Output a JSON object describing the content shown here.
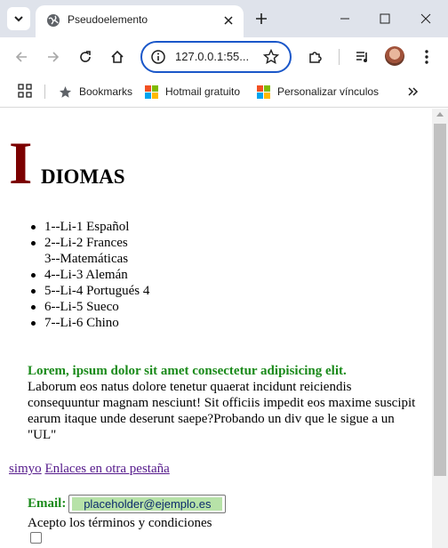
{
  "browser": {
    "tab_title": "Pseudoelemento",
    "url": "127.0.0.1:55...",
    "bookmarks": [
      {
        "label": "Bookmarks",
        "icon": "star-icon"
      },
      {
        "label": "Hotmail gratuito",
        "icon": "microsoft-logo-icon"
      },
      {
        "label": "Personalizar vínculos",
        "icon": "microsoft-logo-icon"
      }
    ]
  },
  "page": {
    "heading_initial": "I",
    "heading_rest": "DIOMAS",
    "languages": [
      "1--Li-1 Español",
      "2--Li-2 Frances",
      "3--Matemáticas",
      "4--Li-3 Alemán",
      "5--Li-4 Portugués 4",
      "6--Li-5 Sueco",
      "7--Li-6 Chino"
    ],
    "lorem_strong": "Lorem, ipsum dolor sit amet consectetur adipisicing elit.",
    "lorem_body": "Laborum eos natus dolore tenetur quaerat incidunt reiciendis consequuntur magnam nesciunt! Sit officiis impedit eos maxime suscipit earum itaque unde deserunt saepe?Probando un div que le sigue a un \"UL\"",
    "link_1": "simyo",
    "link_2": "Enlaces en otra pestaña",
    "email_label": "Email:",
    "email_placeholder": "placeholder@ejemplo.es",
    "terms_text": "Acepto los términos y condiciones",
    "terms_checked": false
  },
  "colors": {
    "drop_cap": "#7b0000",
    "green_text": "#1a8a1a",
    "visited_link": "#551a8b",
    "email_field_fill": "#b7e2a8",
    "omnibox_focus": "#1a57c9"
  }
}
